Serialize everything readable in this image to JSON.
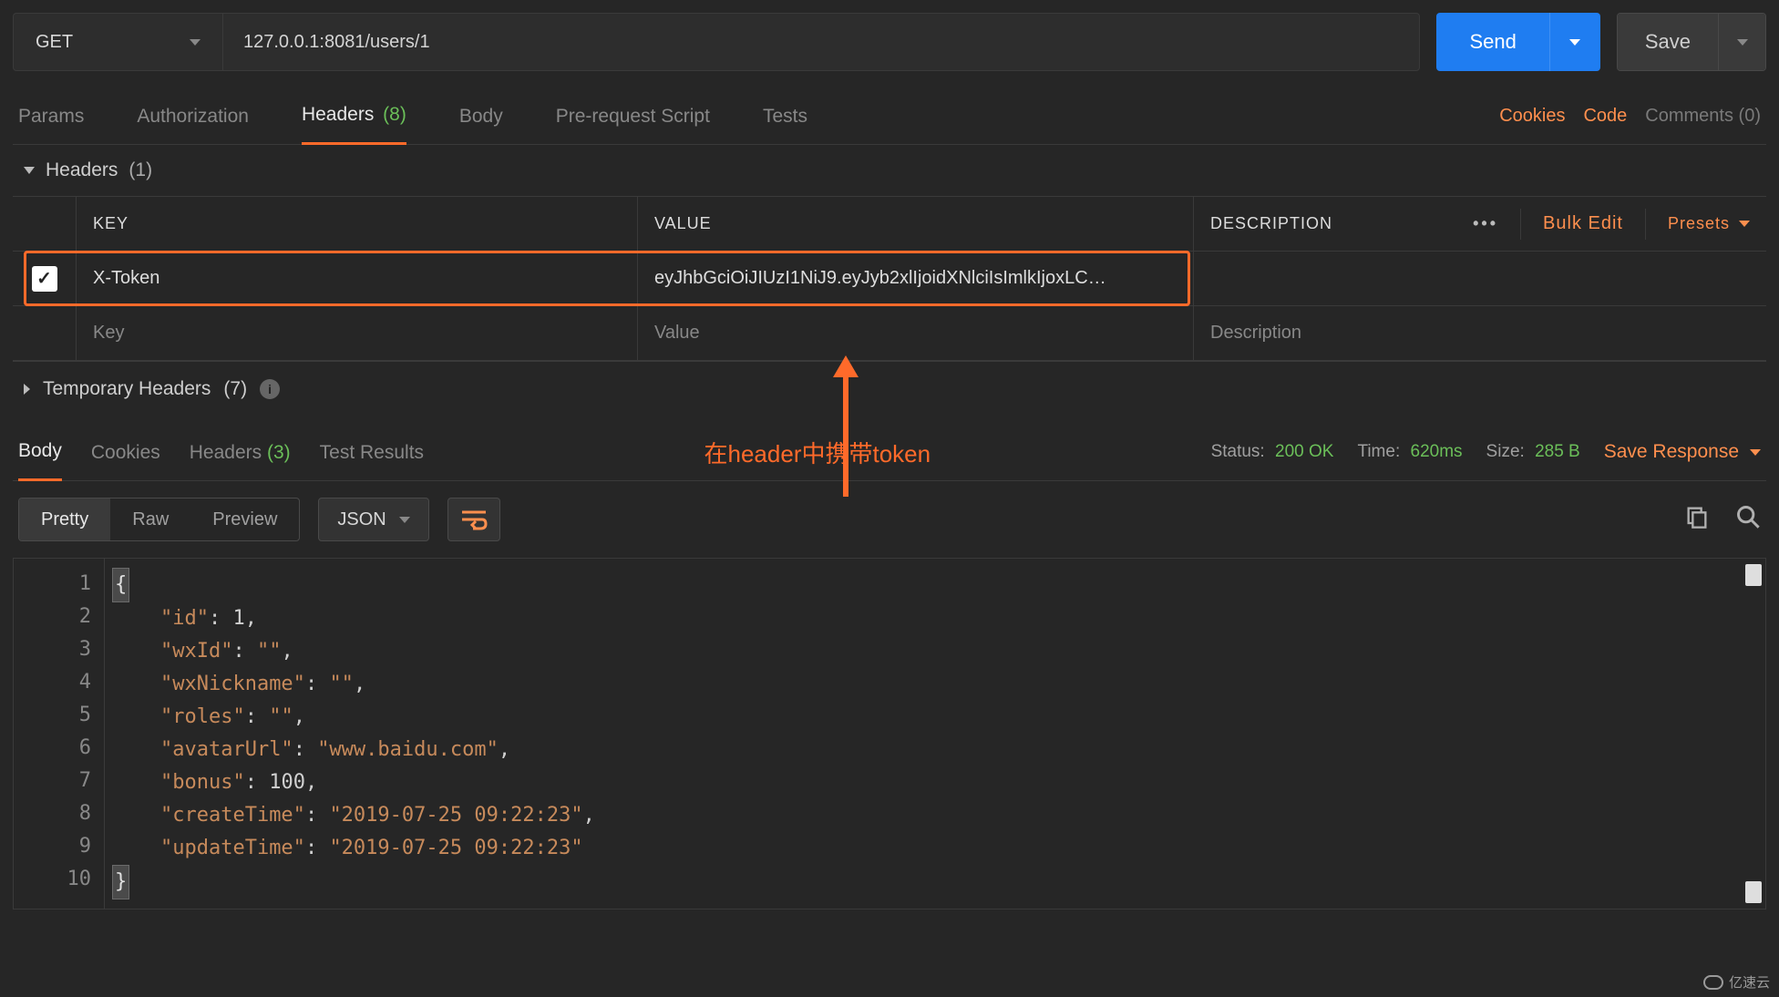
{
  "request": {
    "method": "GET",
    "url": "127.0.0.1:8081/users/1",
    "send": "Send",
    "save": "Save"
  },
  "tabs": {
    "params": "Params",
    "authorization": "Authorization",
    "headers": "Headers",
    "headers_count": "(8)",
    "body": "Body",
    "prerequest": "Pre-request Script",
    "tests": "Tests",
    "cookies": "Cookies",
    "code": "Code",
    "comments": "Comments (0)"
  },
  "headers_section": {
    "title": "Headers",
    "count": "(1)",
    "columns": {
      "key": "KEY",
      "value": "VALUE",
      "description": "DESCRIPTION"
    },
    "bulk_edit": "Bulk Edit",
    "presets": "Presets",
    "row": {
      "key": "X-Token",
      "value": "eyJhbGciOiJIUzI1NiJ9.eyJyb2xlIjoidXNlciIsImlkIjoxLC…"
    },
    "placeholders": {
      "key": "Key",
      "value": "Value",
      "description": "Description"
    },
    "temp_title": "Temporary Headers",
    "temp_count": "(7)"
  },
  "annotation": "在header中携带token",
  "response": {
    "tabs": {
      "body": "Body",
      "cookies": "Cookies",
      "headers": "Headers",
      "headers_count": "(3)",
      "test_results": "Test Results"
    },
    "status_label": "Status:",
    "status_value": "200 OK",
    "time_label": "Time:",
    "time_value": "620ms",
    "size_label": "Size:",
    "size_value": "285 B",
    "save_response": "Save Response"
  },
  "viewer": {
    "pretty": "Pretty",
    "raw": "Raw",
    "preview": "Preview",
    "format": "JSON"
  },
  "code_lines": [
    "1",
    "2",
    "3",
    "4",
    "5",
    "6",
    "7",
    "8",
    "9",
    "10"
  ],
  "response_body": {
    "id": 1,
    "wxId": "",
    "wxNickname": "",
    "roles": "",
    "avatarUrl": "www.baidu.com",
    "bonus": 100,
    "createTime": "2019-07-25 09:22:23",
    "updateTime": "2019-07-25 09:22:23"
  },
  "watermark": "亿速云"
}
